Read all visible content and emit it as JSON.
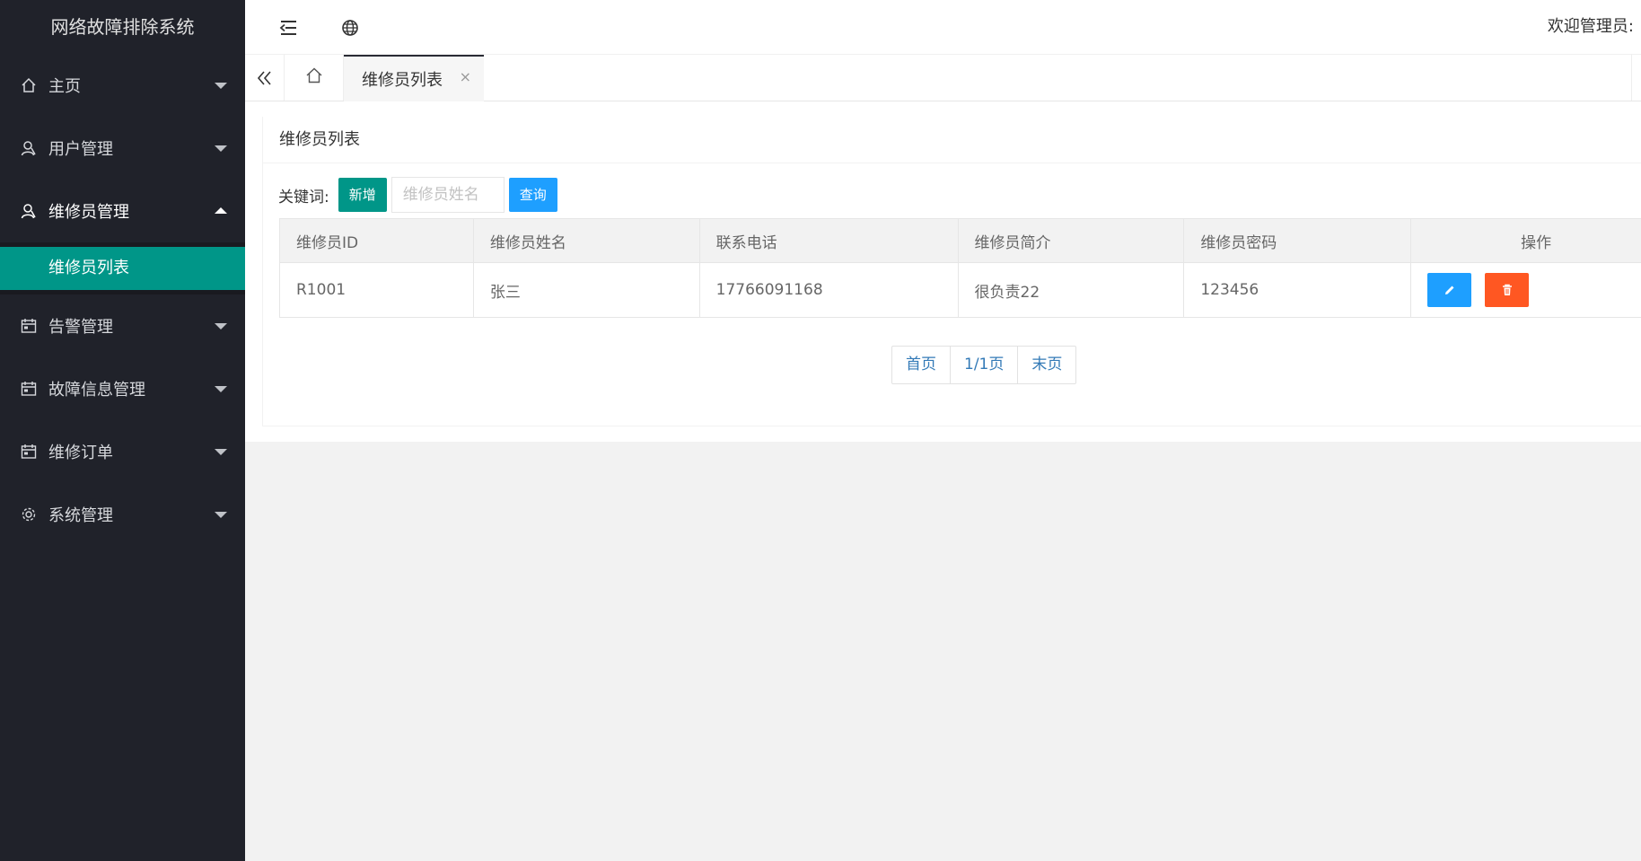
{
  "app": {
    "title": "网络故障排除系统"
  },
  "header": {
    "welcome": "欢迎管理员:"
  },
  "sidebar": {
    "items": [
      {
        "label": "主页",
        "icon": "home-icon"
      },
      {
        "label": "用户管理",
        "icon": "user-icon"
      },
      {
        "label": "维修员管理",
        "icon": "user-icon",
        "open": true,
        "children": [
          {
            "label": "维修员列表",
            "active": true
          }
        ]
      },
      {
        "label": "告警管理",
        "icon": "calendar-icon"
      },
      {
        "label": "故障信息管理",
        "icon": "calendar-icon"
      },
      {
        "label": "维修订单",
        "icon": "calendar-icon"
      },
      {
        "label": "系统管理",
        "icon": "gear-icon"
      }
    ]
  },
  "tabs": {
    "active_label": "维修员列表",
    "close": "×"
  },
  "main": {
    "card_title": "维修员列表",
    "toolbar": {
      "keyword_label": "关键词:",
      "add_label": "新增",
      "search_placeholder": "维修员姓名",
      "query_label": "查询"
    },
    "table": {
      "headers": [
        "维修员ID",
        "维修员姓名",
        "联系电话",
        "维修员简介",
        "维修员密码",
        "操作"
      ],
      "rows": [
        [
          "R1001",
          "张三",
          "17766091168",
          "很负责22",
          "123456"
        ]
      ]
    },
    "pager": {
      "first": "首页",
      "current": "1/1页",
      "last": "末页"
    }
  },
  "colors": {
    "sidebar_bg": "#20222a",
    "accent": "#009688",
    "blue": "#1e9fff",
    "danger": "#ff5722"
  }
}
